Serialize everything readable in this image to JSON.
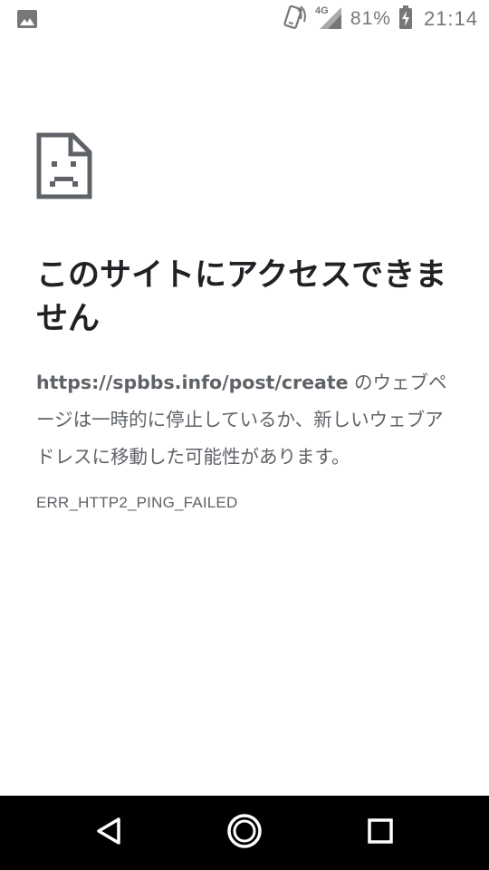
{
  "status_bar": {
    "left_icon": "image-notification-icon",
    "icons": [
      "nfc-icon",
      "signal-4g-icon"
    ],
    "network_label": "4G",
    "battery_percent": "81%",
    "battery_icon": "battery-charging-icon",
    "time": "21:14"
  },
  "error_page": {
    "icon": "sad-document-icon",
    "heading": "このサイトにアクセスできません",
    "url": "https://spbbs.info/post/create",
    "message": " のウェブページは一時的に停止しているか、新しいウェブアドレスに移動した可能性があります。",
    "error_code": "ERR_HTTP2_PING_FAILED"
  },
  "nav_bar": {
    "buttons": [
      "back-icon",
      "home-icon",
      "recents-icon"
    ]
  },
  "colors": {
    "heading": "#202124",
    "body": "#5f6368",
    "status": "#777777",
    "nav_background": "#000000"
  }
}
